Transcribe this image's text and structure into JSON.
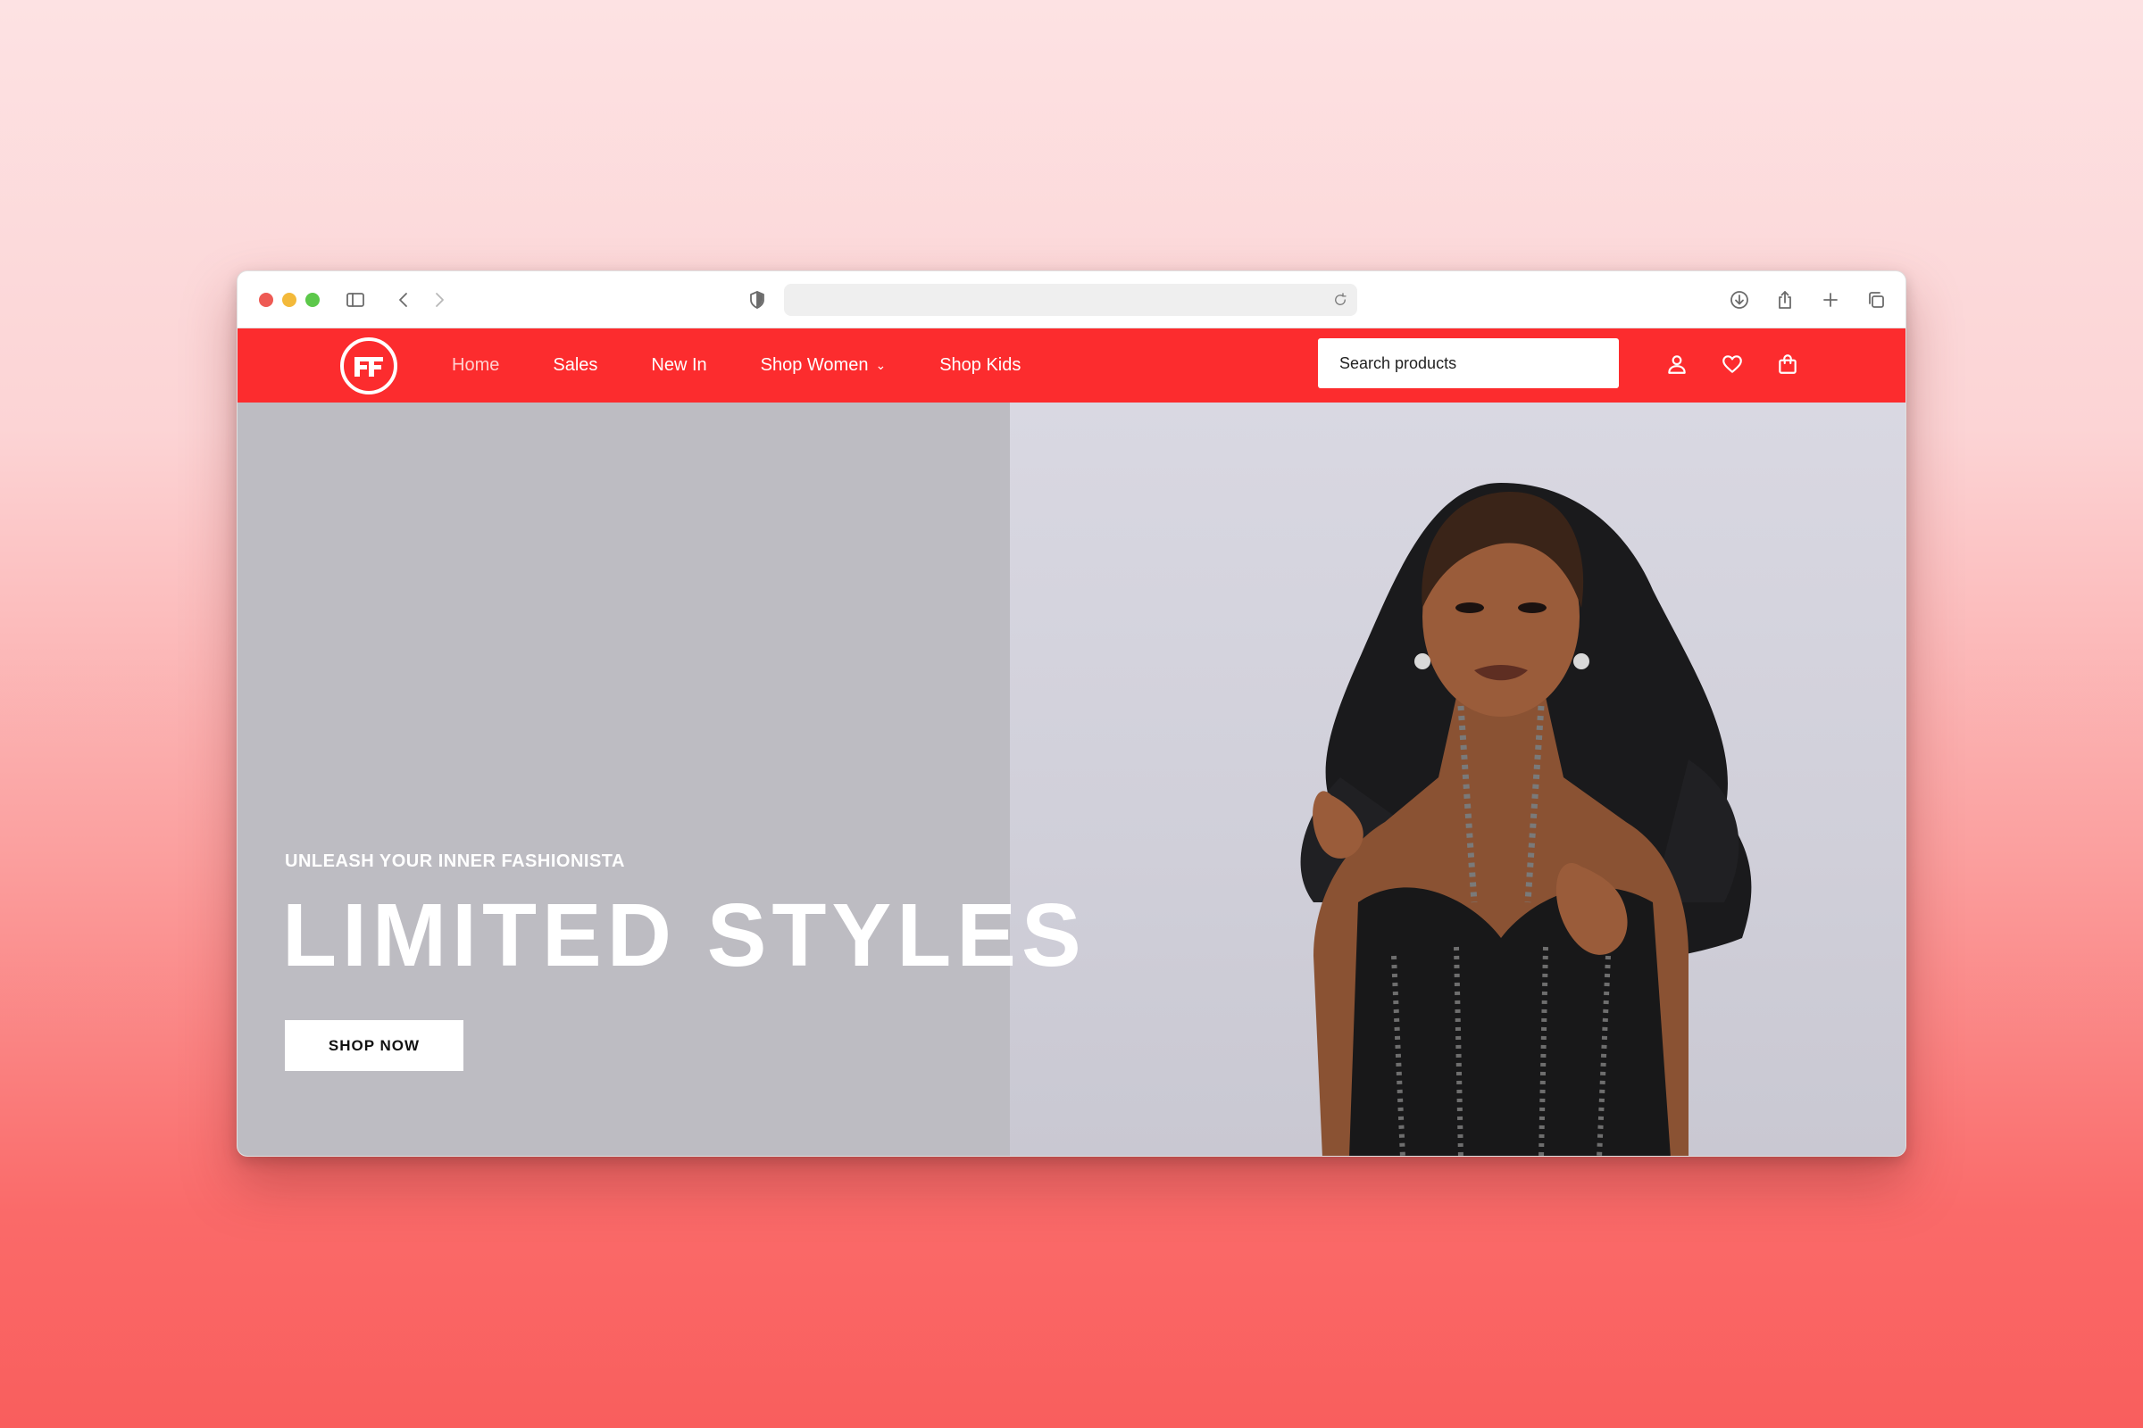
{
  "browser": {
    "url": ""
  },
  "brand": {
    "logo_name": "ff-logo",
    "accent_color": "#fc2c2e"
  },
  "nav": {
    "items": [
      {
        "label": "Home",
        "active": true
      },
      {
        "label": "Sales",
        "active": false
      },
      {
        "label": "New In",
        "active": false
      },
      {
        "label": "Shop Women",
        "active": false,
        "has_dropdown": true
      },
      {
        "label": "Shop Kids",
        "active": false
      }
    ],
    "search_placeholder": "Search products",
    "icons": [
      "user-icon",
      "heart-icon",
      "bag-icon"
    ]
  },
  "hero": {
    "eyebrow": "UNLEASH YOUR INNER FASHIONISTA",
    "headline": "LIMITED STYLES",
    "cta_label": "SHOP NOW",
    "image_alt": "model-photo"
  }
}
